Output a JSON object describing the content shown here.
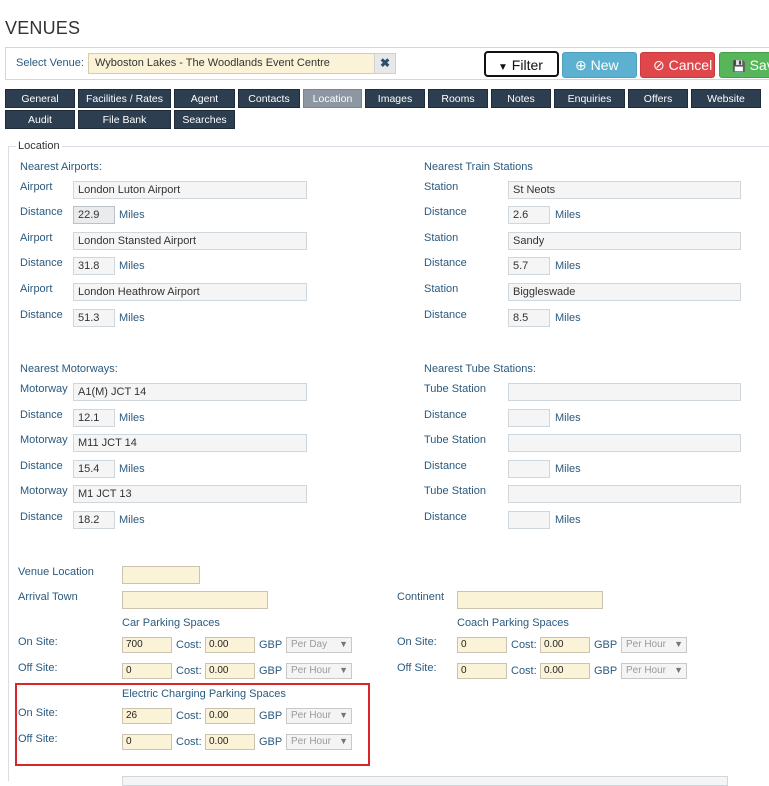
{
  "page": {
    "title": "VENUES"
  },
  "venue_bar": {
    "label": "Select Venue:",
    "selected": "Wyboston Lakes - The Woodlands Event Centre",
    "clear_glyph": "✖"
  },
  "actions": {
    "filter": "Filter",
    "new": "New",
    "cancel": "Cancel",
    "save": "Save"
  },
  "icons": {
    "filter": "▼",
    "new": "⊕",
    "cancel": "⊘",
    "save": "💾"
  },
  "tabs": {
    "row1": [
      "General",
      "Facilities / Rates",
      "Agent",
      "Contacts",
      "Location",
      "Images",
      "Rooms",
      "Notes",
      "Enquiries",
      "Offers",
      "Website"
    ],
    "row2": [
      "Audit",
      "File Bank",
      "Searches"
    ],
    "active": "Location"
  },
  "location": {
    "legend": "Location",
    "airports": {
      "heading": "Nearest Airports:",
      "item_label": "Airport",
      "distance_label": "Distance",
      "unit": "Miles",
      "items": [
        {
          "name": "London Luton Airport",
          "distance": "22.9"
        },
        {
          "name": "London Stansted Airport",
          "distance": "31.8"
        },
        {
          "name": "London Heathrow Airport",
          "distance": "51.3"
        }
      ]
    },
    "trains": {
      "heading": "Nearest Train Stations",
      "item_label": "Station",
      "distance_label": "Distance",
      "unit": "Miles",
      "items": [
        {
          "name": "St Neots",
          "distance": "2.6"
        },
        {
          "name": "Sandy",
          "distance": "5.7"
        },
        {
          "name": "Biggleswade",
          "distance": "8.5"
        }
      ]
    },
    "motorways": {
      "heading": "Nearest Motorways:",
      "item_label": "Motorway",
      "distance_label": "Distance",
      "unit": "Miles",
      "items": [
        {
          "name": "A1(M) JCT 14",
          "distance": "12.1"
        },
        {
          "name": "M11 JCT 14",
          "distance": "15.4"
        },
        {
          "name": "M1 JCT 13",
          "distance": "18.2"
        }
      ]
    },
    "tubes": {
      "heading": "Nearest Tube Stations:",
      "item_label": "Tube Station",
      "distance_label": "Distance",
      "unit": "Miles",
      "items": [
        {
          "name": "",
          "distance": ""
        },
        {
          "name": "",
          "distance": ""
        },
        {
          "name": "",
          "distance": ""
        }
      ]
    },
    "venue_location_label": "Venue Location",
    "venue_location_value": "",
    "arrival_town_label": "Arrival Town",
    "arrival_town_value": "",
    "continent_label": "Continent",
    "continent_value": ""
  },
  "parking": {
    "cost_label": "Cost:",
    "currency": "GBP",
    "on_site_label": "On Site:",
    "off_site_label": "Off Site:",
    "car": {
      "heading": "Car Parking Spaces",
      "on_site": {
        "spaces": "700",
        "cost": "0.00",
        "period": "Per Day"
      },
      "off_site": {
        "spaces": "0",
        "cost": "0.00",
        "period": "Per Hour"
      }
    },
    "coach": {
      "heading": "Coach Parking Spaces",
      "on_site": {
        "spaces": "0",
        "cost": "0.00",
        "period": "Per Hour"
      },
      "off_site": {
        "spaces": "0",
        "cost": "0.00",
        "period": "Per Hour"
      }
    },
    "electric": {
      "heading": "Electric Charging Parking Spaces",
      "on_site": {
        "spaces": "26",
        "cost": "0.00",
        "period": "Per Hour"
      },
      "off_site": {
        "spaces": "0",
        "cost": "0.00",
        "period": "Per Hour"
      }
    }
  },
  "colors": {
    "tab_bg": "#2c3e50",
    "tab_active_bg": "#8c97a1",
    "label_blue": "#2b5a7e",
    "cream_input": "#fbf3d8",
    "highlight_red": "#d9262b",
    "btn_new": "#5bb1cf",
    "btn_cancel": "#e0474a",
    "btn_save": "#57b55a"
  }
}
